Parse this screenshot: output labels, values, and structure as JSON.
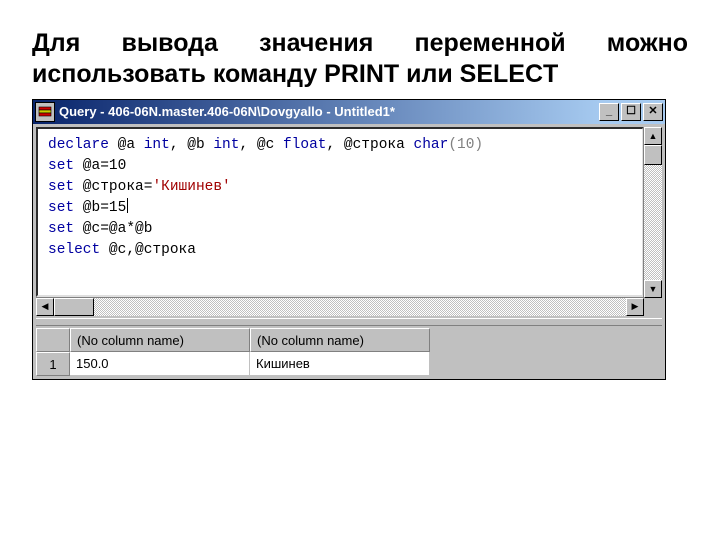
{
  "heading": "Для вывода значения переменной можно использовать команду PRINT или SELECT",
  "window": {
    "title": "Query - 406-06N.master.406-06N\\Dovgyallo - Untitled1*"
  },
  "code": {
    "l1": {
      "a": "declare",
      "vars": " @a ",
      "t1": "int",
      "c1": ", @b ",
      "t2": "int",
      "c2": ", @c ",
      "t3": "float",
      "c3": ", @строка ",
      "t4": "char",
      "p": "(10)"
    },
    "l2": {
      "a": "set",
      "b": " @a=10"
    },
    "l3": {
      "a": "set",
      "b": " @строка=",
      "s": "'Кишинев'"
    },
    "l4": {
      "a": "set",
      "b": " @b=15"
    },
    "l5": {
      "a": "set",
      "b": " @c=@a*@b"
    },
    "l6": {
      "a": "select",
      "b": " @c,@строка"
    }
  },
  "result": {
    "headers": [
      "(No column name)",
      "(No column name)"
    ],
    "rownum": "1",
    "cells": [
      "150.0",
      "Кишинев"
    ]
  },
  "icons": {
    "minimize": "_",
    "maximize": "☐",
    "close": "✕",
    "up": "▲",
    "down": "▼",
    "left": "◀",
    "right": "▶"
  }
}
